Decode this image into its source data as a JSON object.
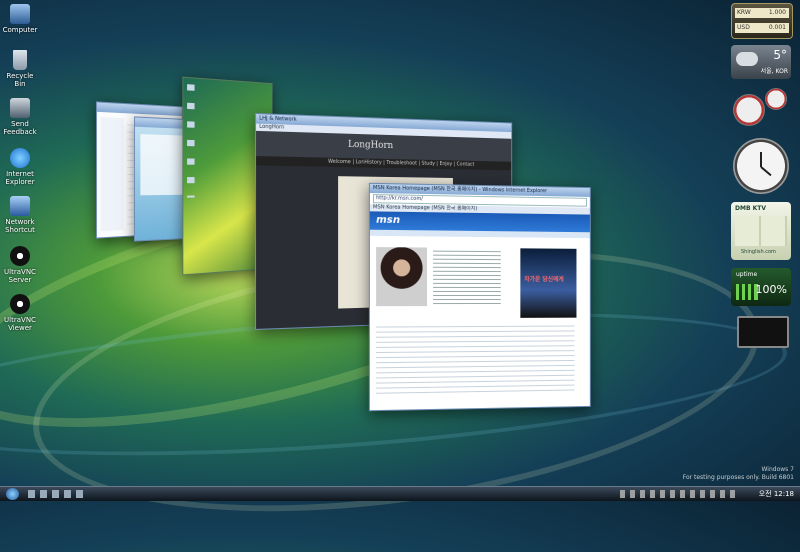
{
  "desktop_icons": [
    {
      "label": "Computer"
    },
    {
      "label": "Recycle Bin"
    },
    {
      "label": "Send Feedback"
    },
    {
      "label": "Internet Explorer"
    },
    {
      "label": "Network Shortcut"
    },
    {
      "label": "UltraVNC Server"
    },
    {
      "label": "UltraVNC Viewer"
    }
  ],
  "windows": {
    "msn": {
      "title": "MSN Korea Homepage (MSN 한국 홈페이지) - Windows Internet Explorer",
      "address": "http://kr.msn.com/",
      "tab": "MSN Korea Homepage (MSN 한국 홈페이지)",
      "logo": "msn",
      "ad_text": "차가운 당신에게"
    },
    "longhorn": {
      "title": "LHJ & Network",
      "tab": "LongHorn",
      "logo": "LongHorn",
      "nav": "Welcome | LonHistory | Troubleshoot | Study | Enjoy | Contact"
    }
  },
  "gadgets": {
    "currency": {
      "row1_label": "KRW",
      "row1_value": "1.000",
      "row2_label": "USD",
      "row2_value": "0.001"
    },
    "weather": {
      "temp": "5°",
      "location": "서울, KOR"
    },
    "dmb": {
      "title": "DMB KTV",
      "link": "Shinglish.com"
    },
    "uptime": {
      "title": "uptime",
      "value": "100%"
    }
  },
  "watermark": {
    "line1": "Windows 7",
    "line2": "For testing purposes only. Build 6801"
  },
  "taskbar": {
    "clock": "오전 12:18"
  }
}
